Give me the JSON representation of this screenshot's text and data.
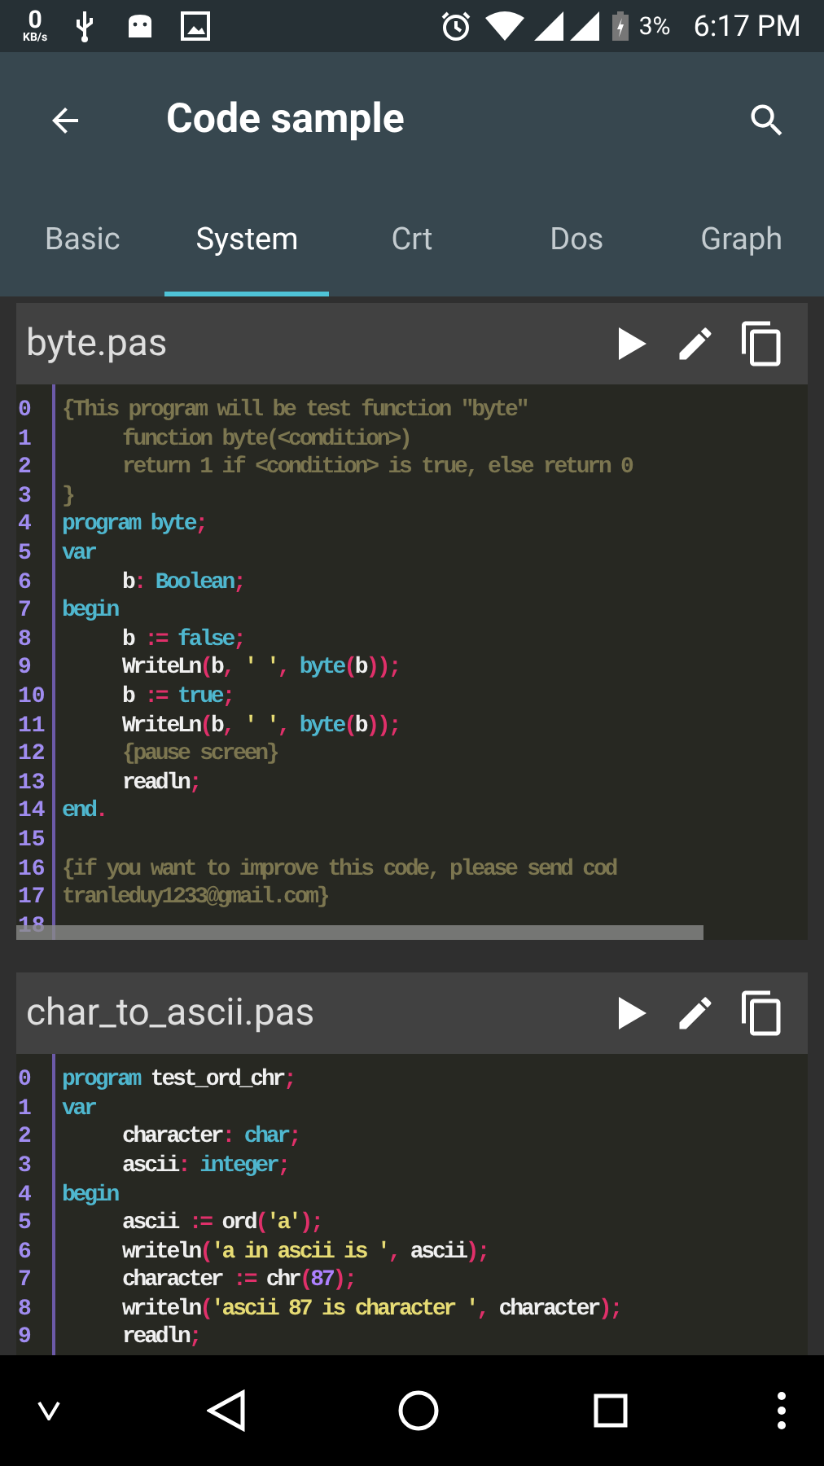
{
  "status_bar": {
    "speed": "0",
    "speed_unit": "KB/s",
    "battery": "3%",
    "time": "6:17 PM"
  },
  "toolbar": {
    "title": "Code sample"
  },
  "tabs": [
    {
      "label": "Basic",
      "selected": false
    },
    {
      "label": "System",
      "selected": true
    },
    {
      "label": "Crt",
      "selected": false
    },
    {
      "label": "Dos",
      "selected": false
    },
    {
      "label": "Graph",
      "selected": false
    }
  ],
  "cards": [
    {
      "title": "byte.pas",
      "scrollbar": true,
      "lines": [
        {
          "number": "0",
          "indented": false,
          "tokens": [
            {
              "kind": "comment",
              "text": "{This program will be test function \"byte\""
            }
          ]
        },
        {
          "number": "1",
          "indented": true,
          "tokens": [
            {
              "kind": "comment",
              "text": "function byte(<condition>)"
            }
          ]
        },
        {
          "number": "2",
          "indented": true,
          "tokens": [
            {
              "kind": "comment",
              "text": "return 1 if <condition> is true, else return 0"
            }
          ]
        },
        {
          "number": "3",
          "indented": false,
          "tokens": [
            {
              "kind": "comment",
              "text": "}"
            }
          ]
        },
        {
          "number": "4",
          "indented": false,
          "tokens": [
            {
              "kind": "keyword",
              "text": "program byte"
            },
            {
              "kind": "punct",
              "text": ";"
            }
          ]
        },
        {
          "number": "5",
          "indented": false,
          "tokens": [
            {
              "kind": "keyword",
              "text": "var"
            }
          ]
        },
        {
          "number": "6",
          "indented": true,
          "tokens": [
            {
              "kind": "ident",
              "text": "b"
            },
            {
              "kind": "punct",
              "text": ":"
            },
            {
              "kind": "keyword",
              "text": " Boolean"
            },
            {
              "kind": "punct",
              "text": ";"
            }
          ]
        },
        {
          "number": "7",
          "indented": false,
          "tokens": [
            {
              "kind": "keyword",
              "text": "begin"
            }
          ]
        },
        {
          "number": "8",
          "indented": true,
          "tokens": [
            {
              "kind": "ident",
              "text": "b "
            },
            {
              "kind": "punct",
              "text": ":="
            },
            {
              "kind": "keyword",
              "text": " false"
            },
            {
              "kind": "punct",
              "text": ";"
            }
          ]
        },
        {
          "number": "9",
          "indented": true,
          "tokens": [
            {
              "kind": "ident",
              "text": "WriteLn"
            },
            {
              "kind": "punct",
              "text": "("
            },
            {
              "kind": "ident",
              "text": "b"
            },
            {
              "kind": "punct",
              "text": ","
            },
            {
              "kind": "string",
              "text": " ' '"
            },
            {
              "kind": "punct",
              "text": ","
            },
            {
              "kind": "keyword",
              "text": " byte"
            },
            {
              "kind": "punct",
              "text": "("
            },
            {
              "kind": "ident",
              "text": "b"
            },
            {
              "kind": "punct",
              "text": "));"
            }
          ]
        },
        {
          "number": "10",
          "indented": true,
          "tokens": [
            {
              "kind": "ident",
              "text": "b "
            },
            {
              "kind": "punct",
              "text": ":="
            },
            {
              "kind": "keyword",
              "text": " true"
            },
            {
              "kind": "punct",
              "text": ";"
            }
          ]
        },
        {
          "number": "11",
          "indented": true,
          "tokens": [
            {
              "kind": "ident",
              "text": "WriteLn"
            },
            {
              "kind": "punct",
              "text": "("
            },
            {
              "kind": "ident",
              "text": "b"
            },
            {
              "kind": "punct",
              "text": ","
            },
            {
              "kind": "string",
              "text": " ' '"
            },
            {
              "kind": "punct",
              "text": ","
            },
            {
              "kind": "keyword",
              "text": " byte"
            },
            {
              "kind": "punct",
              "text": "("
            },
            {
              "kind": "ident",
              "text": "b"
            },
            {
              "kind": "punct",
              "text": "));"
            }
          ]
        },
        {
          "number": "12",
          "indented": true,
          "tokens": [
            {
              "kind": "comment",
              "text": "{pause screen}"
            }
          ]
        },
        {
          "number": "13",
          "indented": true,
          "tokens": [
            {
              "kind": "ident",
              "text": "readln"
            },
            {
              "kind": "punct",
              "text": ";"
            }
          ]
        },
        {
          "number": "14",
          "indented": false,
          "tokens": [
            {
              "kind": "keyword",
              "text": "end"
            },
            {
              "kind": "punct",
              "text": "."
            }
          ]
        },
        {
          "number": "15"
        },
        {
          "number": "16",
          "indented": false,
          "tokens": [
            {
              "kind": "comment",
              "text": "{if you want to improve this code, please send cod"
            }
          ]
        },
        {
          "number": "17",
          "indented": false,
          "tokens": [
            {
              "kind": "comment",
              "text": "tranleduy1233@gmail.com}"
            }
          ]
        },
        {
          "number": "18"
        }
      ]
    },
    {
      "title": "char_to_ascii.pas",
      "lines": [
        {
          "number": "0",
          "indented": false,
          "tokens": [
            {
              "kind": "keyword",
              "text": "program"
            },
            {
              "kind": "ident",
              "text": " test_ord_chr"
            },
            {
              "kind": "punct",
              "text": ";"
            }
          ]
        },
        {
          "number": "1",
          "indented": false,
          "tokens": [
            {
              "kind": "keyword",
              "text": "var"
            }
          ]
        },
        {
          "number": "2",
          "indented": true,
          "tokens": [
            {
              "kind": "ident",
              "text": "character"
            },
            {
              "kind": "punct",
              "text": ":"
            },
            {
              "kind": "keyword",
              "text": " char"
            },
            {
              "kind": "punct",
              "text": ";"
            }
          ]
        },
        {
          "number": "3",
          "indented": true,
          "tokens": [
            {
              "kind": "ident",
              "text": "ascii"
            },
            {
              "kind": "punct",
              "text": ":"
            },
            {
              "kind": "keyword",
              "text": " integer"
            },
            {
              "kind": "punct",
              "text": ";"
            }
          ]
        },
        {
          "number": "4",
          "indented": false,
          "tokens": [
            {
              "kind": "keyword",
              "text": "begin"
            }
          ]
        },
        {
          "number": "5",
          "indented": true,
          "tokens": [
            {
              "kind": "ident",
              "text": "ascii "
            },
            {
              "kind": "punct",
              "text": ":="
            },
            {
              "kind": "ident",
              "text": " ord"
            },
            {
              "kind": "punct",
              "text": "("
            },
            {
              "kind": "string",
              "text": "'a'"
            },
            {
              "kind": "punct",
              "text": ");"
            }
          ]
        },
        {
          "number": "6",
          "indented": true,
          "tokens": [
            {
              "kind": "ident",
              "text": "writeln"
            },
            {
              "kind": "punct",
              "text": "("
            },
            {
              "kind": "string",
              "text": "'a in ascii is '"
            },
            {
              "kind": "punct",
              "text": ","
            },
            {
              "kind": "ident",
              "text": " ascii"
            },
            {
              "kind": "punct",
              "text": ");"
            }
          ]
        },
        {
          "number": "7",
          "indented": true,
          "tokens": [
            {
              "kind": "ident",
              "text": "character "
            },
            {
              "kind": "punct",
              "text": ":="
            },
            {
              "kind": "ident",
              "text": " chr"
            },
            {
              "kind": "punct",
              "text": "("
            },
            {
              "kind": "number",
              "text": "87"
            },
            {
              "kind": "punct",
              "text": ");"
            }
          ]
        },
        {
          "number": "8",
          "indented": true,
          "tokens": [
            {
              "kind": "ident",
              "text": "writeln"
            },
            {
              "kind": "punct",
              "text": "("
            },
            {
              "kind": "string",
              "text": "'ascii 87 is character '"
            },
            {
              "kind": "punct",
              "text": ","
            },
            {
              "kind": "ident",
              "text": " character"
            },
            {
              "kind": "punct",
              "text": ");"
            }
          ]
        },
        {
          "number": "9",
          "indented": true,
          "tokens": [
            {
              "kind": "ident",
              "text": "readln"
            },
            {
              "kind": "punct",
              "text": ";"
            }
          ]
        }
      ]
    }
  ]
}
